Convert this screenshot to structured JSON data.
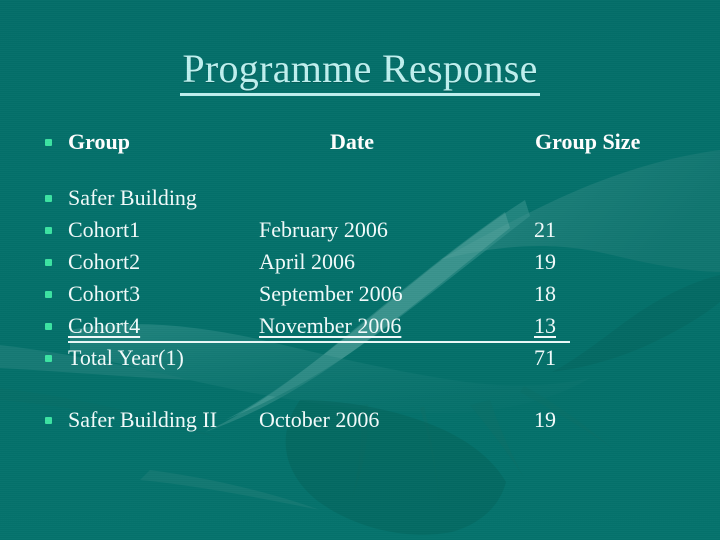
{
  "slide": {
    "title": "Programme Response",
    "background_color": "#04716b",
    "accent_color": "#2c8883",
    "title_color": "#bff0ef",
    "bullet_color": "#3ce3a2",
    "text_color": "#f2fbfb"
  },
  "table": {
    "headers": {
      "group": "Group",
      "date": "Date",
      "size": "Group Size"
    },
    "rows": [
      {
        "group": "Safer Building",
        "date": "",
        "size": ""
      },
      {
        "group": "Cohort1",
        "date": "February 2006",
        "size": "21"
      },
      {
        "group": "Cohort2",
        "date": "April 2006",
        "size": "19"
      },
      {
        "group": "Cohort3",
        "date": "September 2006",
        "size": "18"
      },
      {
        "group": "Cohort4",
        "date": "November 2006",
        "size": "13"
      },
      {
        "group": "Total Year(1)",
        "date": "",
        "size": "71"
      },
      {
        "group": "Safer Building II",
        "date": "October 2006",
        "size": "19"
      }
    ]
  }
}
